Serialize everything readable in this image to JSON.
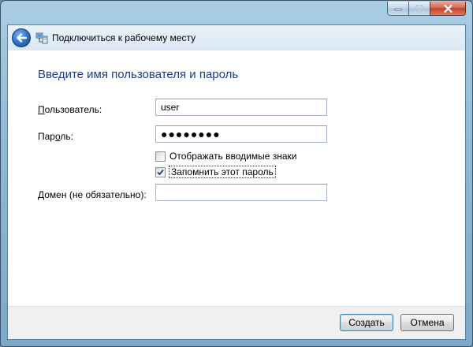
{
  "window": {
    "title": "Подключиться к рабочему месту",
    "controls": [
      "minimize-icon",
      "maximize-icon",
      "close-icon"
    ]
  },
  "nav": {
    "back_icon": "back-arrow-icon",
    "page_icon": "network-workplace-icon",
    "title": "Подключиться к рабочему месту"
  },
  "form": {
    "heading": "Введите имя пользователя и пароль",
    "username_label": "Пользователь:",
    "username_value": "user",
    "password_label": "Пароль:",
    "password_value": "●●●●●●●●",
    "show_chars_label": "Отображать вводимые знаки",
    "show_chars_checked": false,
    "remember_label": "Запомнить этот пароль",
    "remember_checked": true,
    "domain_label": "Домен (не обязательно):",
    "domain_value": ""
  },
  "buttons": {
    "create": "Создать",
    "cancel": "Отмена"
  },
  "colors": {
    "heading": "#1d3a8a",
    "default_button_border": "#3c7fb1"
  }
}
